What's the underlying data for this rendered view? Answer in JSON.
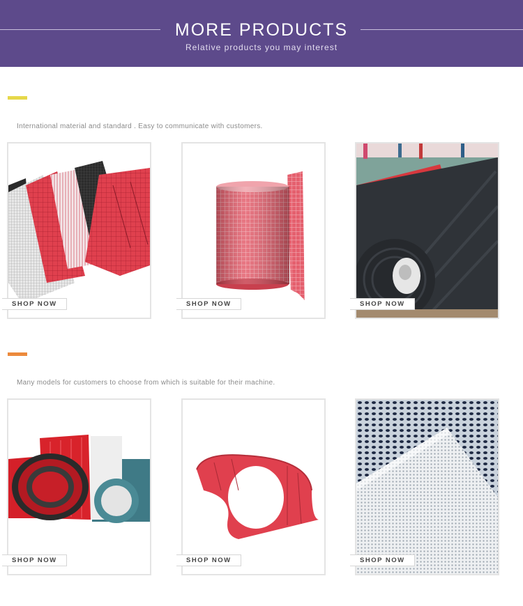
{
  "header": {
    "title": "MORE PRODUCTS",
    "subtitle": "Relative products you may interest"
  },
  "sections": [
    {
      "accent_color": "#e6d84a",
      "description": "International material and standard . Easy to communicate with customers.",
      "products": [
        {
          "image": "layered-mesh-sheets-image",
          "button": "SHOP NOW"
        },
        {
          "image": "red-mesh-roll-image",
          "button": "SHOP NOW"
        },
        {
          "image": "black-fabric-roll-image",
          "button": "SHOP NOW"
        }
      ]
    },
    {
      "accent_color": "#ec8a3c",
      "description": "Many models for customers to choose from which is suitable for their machine.",
      "products": [
        {
          "image": "red-white-belt-rolls-image",
          "button": "SHOP NOW"
        },
        {
          "image": "red-curled-belt-image",
          "button": "SHOP NOW"
        },
        {
          "image": "white-mesh-closeup-image",
          "button": "SHOP NOW"
        }
      ]
    }
  ]
}
